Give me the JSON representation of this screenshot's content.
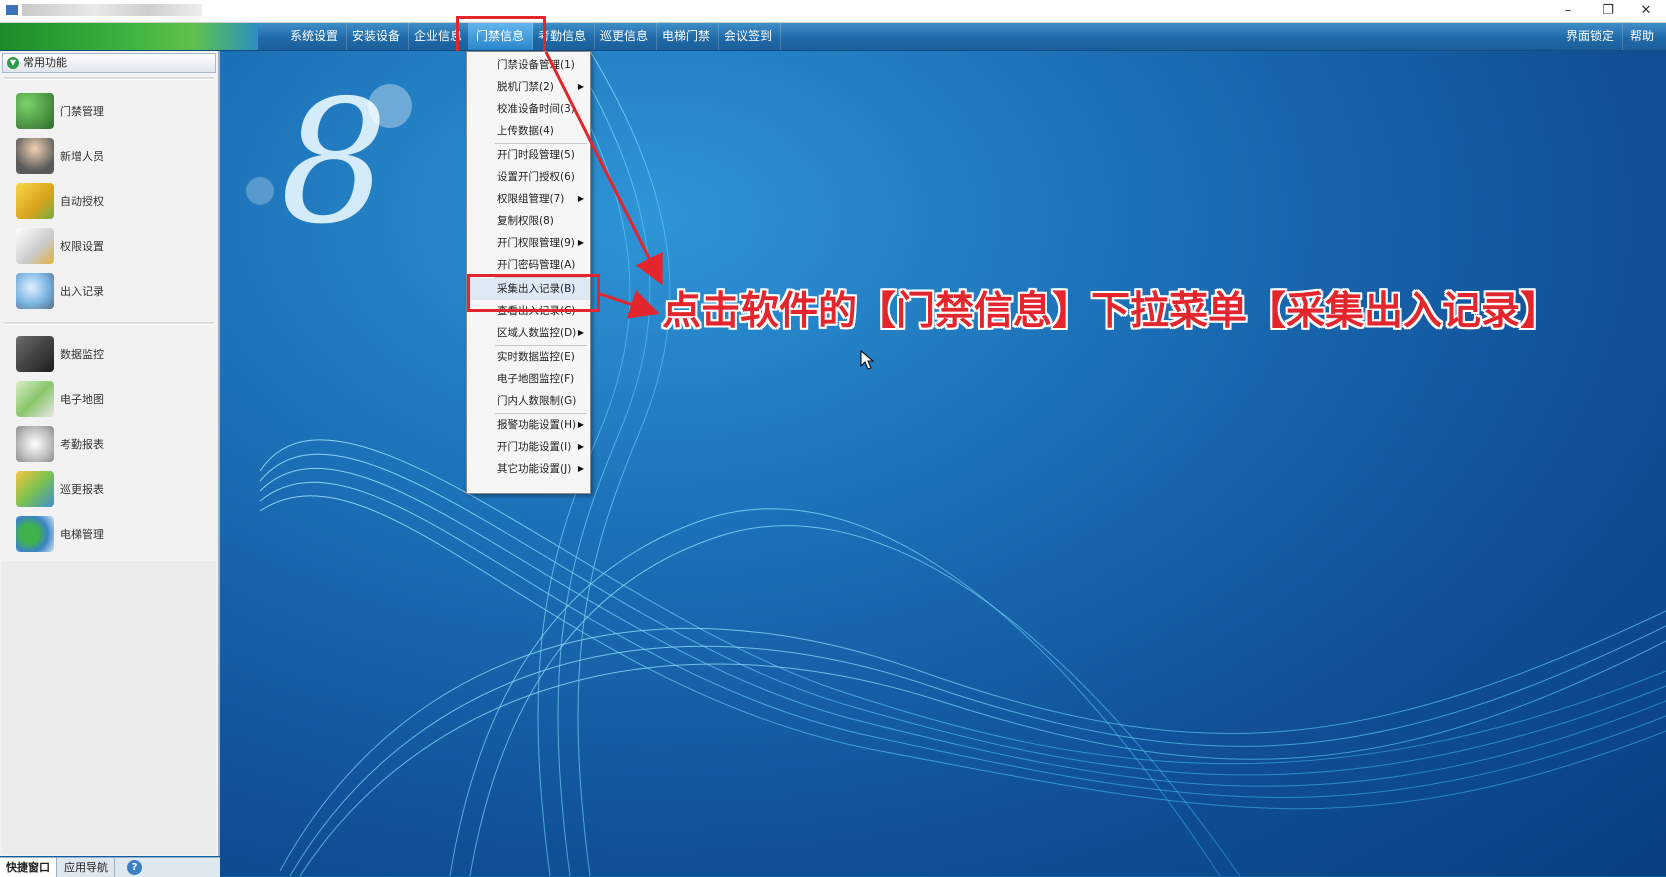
{
  "window": {
    "title": "",
    "controls": {
      "minimize": "–",
      "restore": "❐",
      "close": "✕"
    }
  },
  "menubar": {
    "items": [
      "系统设置",
      "安装设备",
      "企业信息",
      "门禁信息",
      "考勤信息",
      "巡更信息",
      "电梯门禁",
      "会议签到"
    ],
    "active": "门禁信息",
    "right_items": [
      "界面锁定",
      "帮助"
    ]
  },
  "sidebar": {
    "header": "常用功能",
    "items": [
      {
        "label": "门禁管理",
        "icon": "door-access-icon"
      },
      {
        "label": "新增人员",
        "icon": "person-icon"
      },
      {
        "label": "自动授权",
        "icon": "card-icon"
      },
      {
        "label": "权限设置",
        "icon": "permission-icon"
      },
      {
        "label": "出入记录",
        "icon": "magnifier-icon"
      },
      {
        "label": "数据监控",
        "icon": "camera-icon"
      },
      {
        "label": "电子地图",
        "icon": "map-icon"
      },
      {
        "label": "考勤报表",
        "icon": "clock-icon"
      },
      {
        "label": "巡更报表",
        "icon": "stack-icon"
      },
      {
        "label": "电梯管理",
        "icon": "elevator-icon"
      }
    ]
  },
  "bottom_tabs": [
    "快捷窗口",
    "应用导航"
  ],
  "dropdown": {
    "items": [
      {
        "label": "门禁设备管理(1)",
        "submenu": false
      },
      {
        "label": "脱机门禁(2)",
        "submenu": true
      },
      {
        "label": "校准设备时间(3)",
        "submenu": false
      },
      {
        "label": "上传数据(4)",
        "submenu": false
      },
      {
        "label": "开门时段管理(5)",
        "submenu": false
      },
      {
        "label": "设置开门授权(6)",
        "submenu": false
      },
      {
        "label": "权限组管理(7)",
        "submenu": true
      },
      {
        "label": "复制权限(8)",
        "submenu": false
      },
      {
        "label": "开门权限管理(9)",
        "submenu": true
      },
      {
        "label": "开门密码管理(A)",
        "submenu": false
      },
      {
        "label": "采集出入记录(B)",
        "submenu": false
      },
      {
        "label": "查看出入记录(C)",
        "submenu": false
      },
      {
        "label": "区域人数监控(D)",
        "submenu": true
      },
      {
        "label": "实时数据监控(E)",
        "submenu": false
      },
      {
        "label": "电子地图监控(F)",
        "submenu": false
      },
      {
        "label": "门内人数限制(G)",
        "submenu": false
      },
      {
        "label": "报警功能设置(H)",
        "submenu": true
      },
      {
        "label": "开门功能设置(I)",
        "submenu": true
      },
      {
        "label": "其它功能设置(J)",
        "submenu": true
      }
    ],
    "highlighted": "采集出入记录(B)"
  },
  "annotation": "点击软件的【门禁信息】下拉菜单【采集出入记录】",
  "colors": {
    "accent_red": "#e3262d",
    "menubar_blue": "#1f6aa8"
  }
}
